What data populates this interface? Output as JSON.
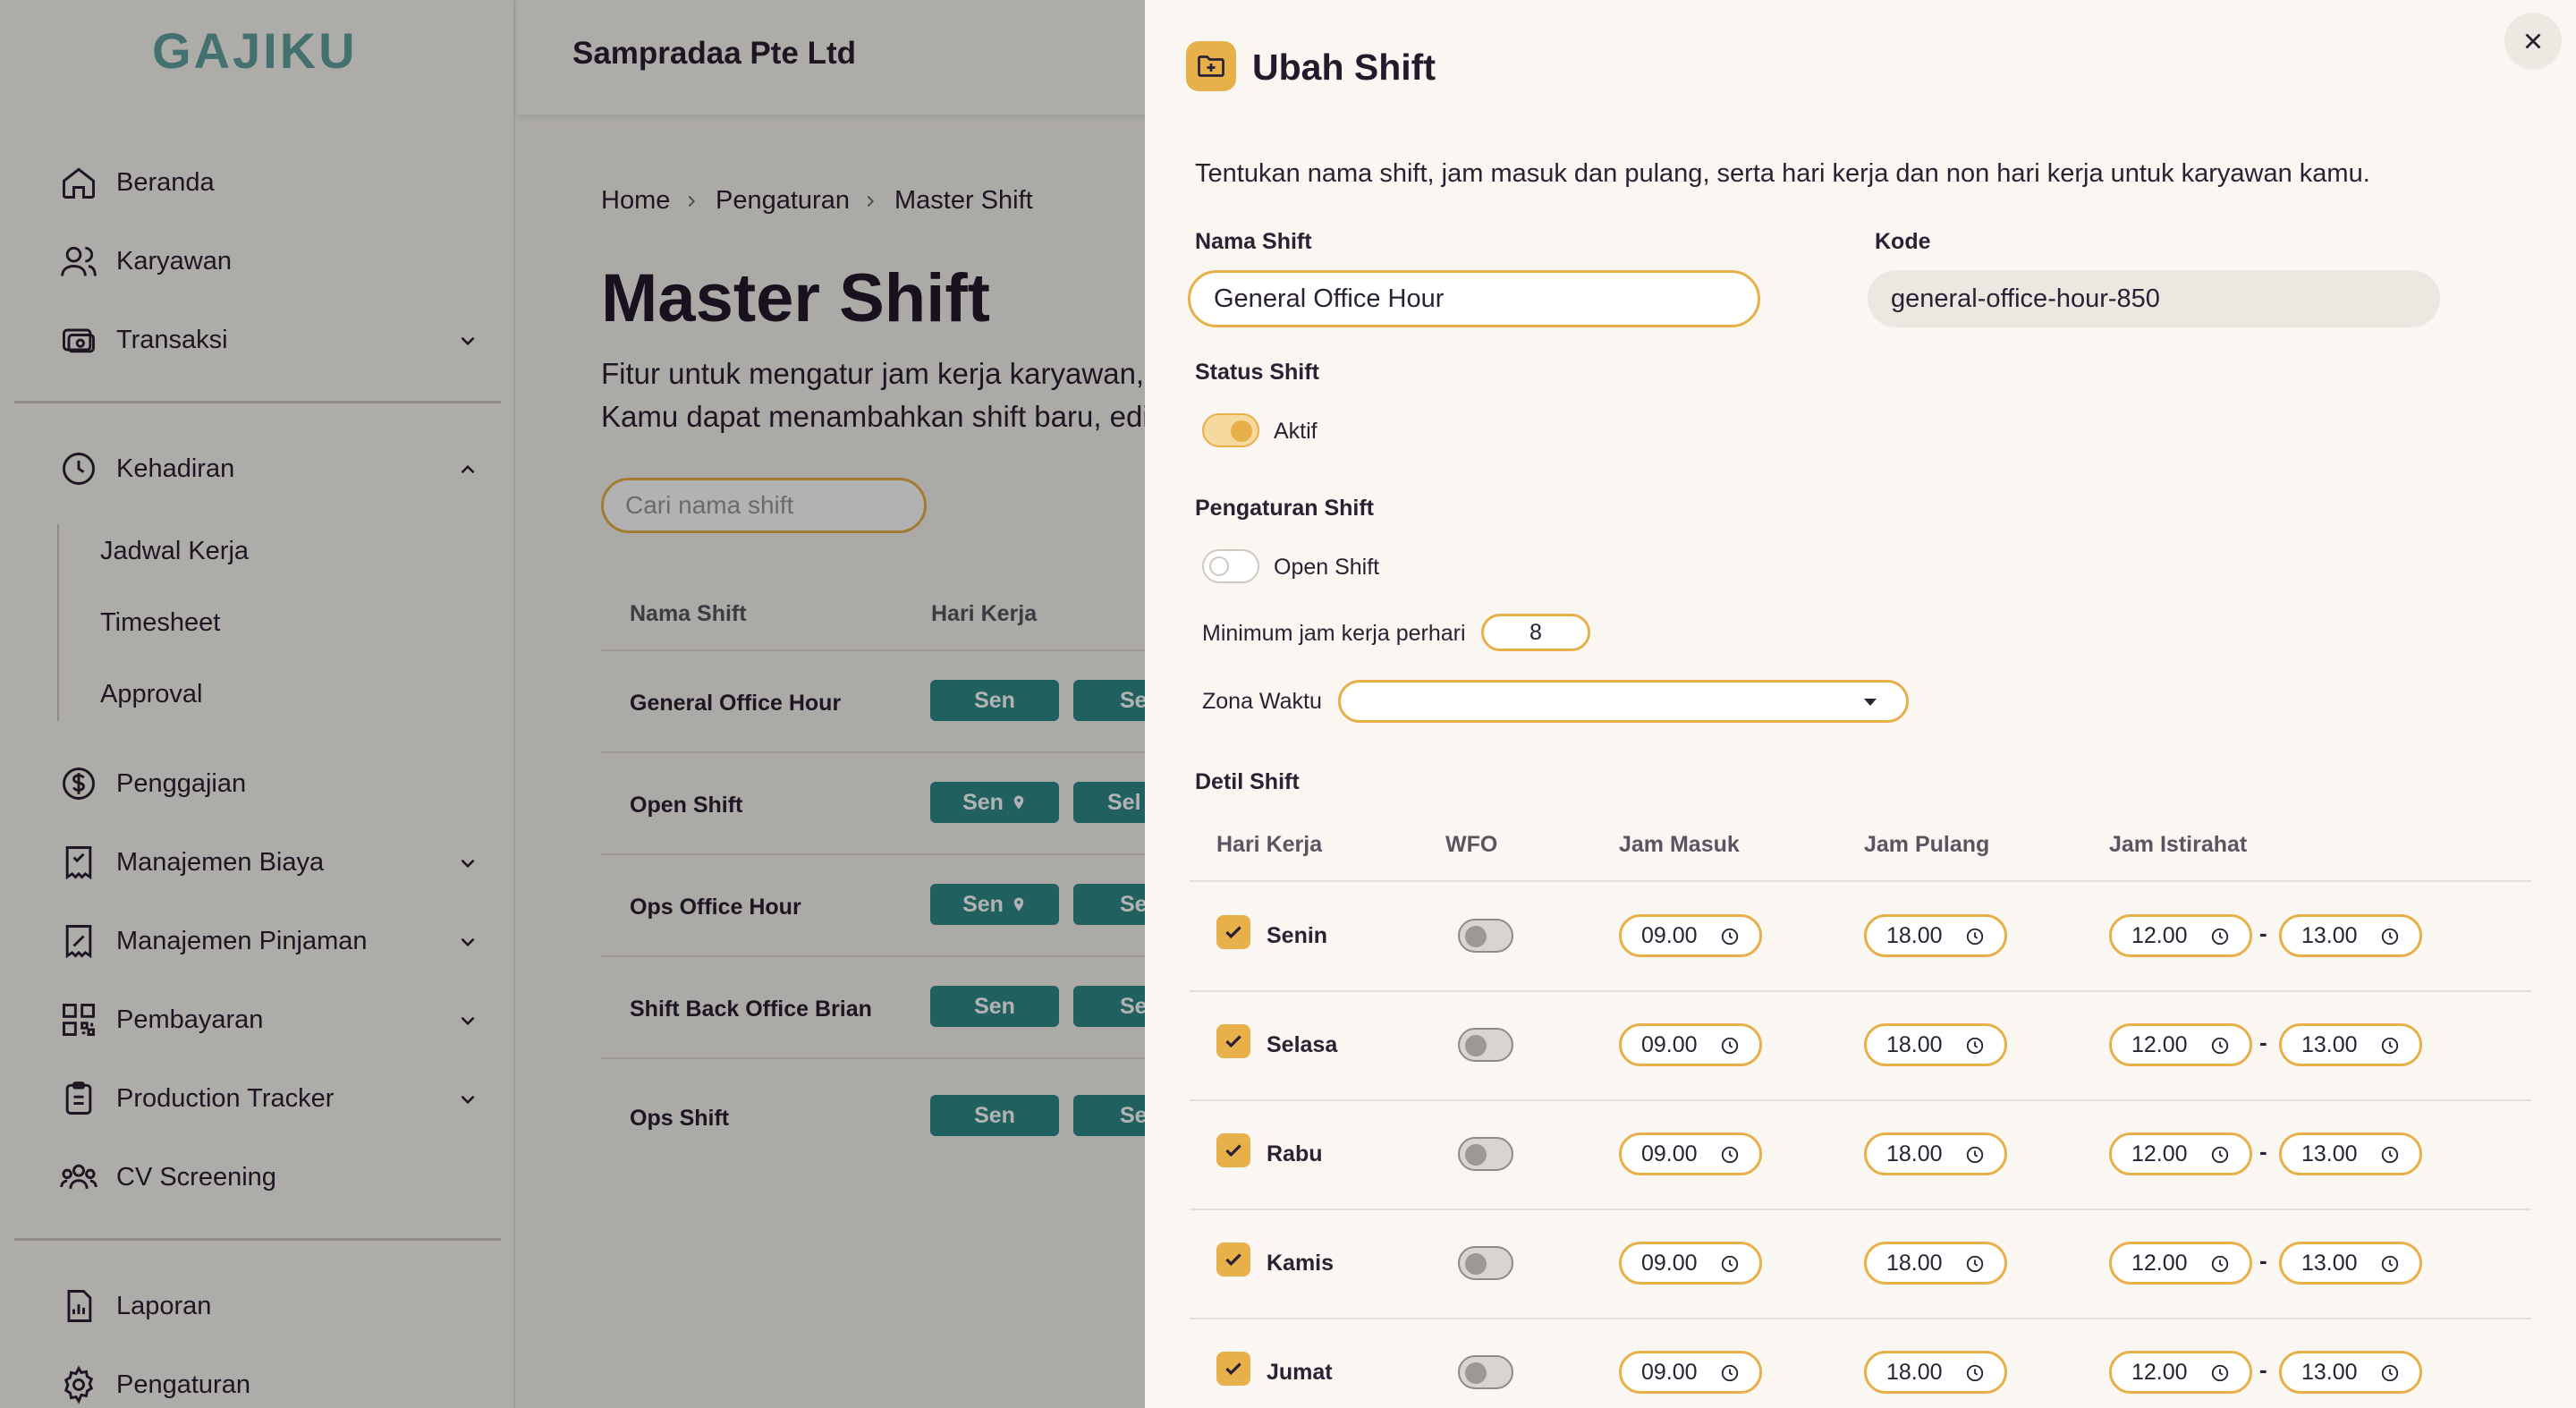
{
  "app": {
    "logo": "GAJIKU",
    "company": "Sampradaa Pte Ltd"
  },
  "sidebar": {
    "items": [
      {
        "label": "Beranda",
        "icon": "home-icon"
      },
      {
        "label": "Karyawan",
        "icon": "users-icon"
      },
      {
        "label": "Transaksi",
        "icon": "transaction-icon"
      },
      {
        "label": "Kehadiran",
        "icon": "clock-icon"
      },
      {
        "label": "Penggajian",
        "icon": "dollar-icon"
      },
      {
        "label": "Manajemen Biaya",
        "icon": "receipt-icon"
      },
      {
        "label": "Manajemen Pinjaman",
        "icon": "loan-icon"
      },
      {
        "label": "Pembayaran",
        "icon": "qr-icon"
      },
      {
        "label": "Production Tracker",
        "icon": "clipboard-icon"
      },
      {
        "label": "CV Screening",
        "icon": "group-icon"
      },
      {
        "label": "Laporan",
        "icon": "report-icon"
      },
      {
        "label": "Pengaturan",
        "icon": "gear-icon"
      }
    ],
    "kehadiran_sub": [
      "Jadwal Kerja",
      "Timesheet",
      "Approval"
    ]
  },
  "breadcrumb": [
    "Home",
    "Pengaturan",
    "Master Shift"
  ],
  "page": {
    "title": "Master Shift",
    "desc_line1": "Fitur untuk mengatur jam kerja karyawan, l",
    "desc_line2": "Kamu dapat menambahkan shift baru, edit",
    "search_placeholder": "Cari nama shift"
  },
  "table": {
    "headers": [
      "Nama Shift",
      "Hari Kerja"
    ],
    "rows": [
      {
        "name": "General Office Hour",
        "day1": "Sen",
        "day2": "Se",
        "pin": false
      },
      {
        "name": "Open Shift",
        "day1": "Sen",
        "day2": "Sel",
        "pin": true
      },
      {
        "name": "Ops Office Hour",
        "day1": "Sen",
        "day2": "Se",
        "pin": true
      },
      {
        "name": "Shift Back Office Brian",
        "day1": "Sen",
        "day2": "Se",
        "pin": false
      },
      {
        "name": "Ops Shift",
        "day1": "Sen",
        "day2": "Se",
        "pin": false
      }
    ]
  },
  "drawer": {
    "title": "Ubah Shift",
    "description": "Tentukan nama shift, jam masuk dan pulang, serta hari kerja dan non hari kerja untuk karyawan kamu.",
    "nama_shift_label": "Nama Shift",
    "nama_shift_value": "General Office Hour",
    "kode_label": "Kode",
    "kode_value": "general-office-hour-850",
    "status_label": "Status Shift",
    "status_toggle_label": "Aktif",
    "status_on": true,
    "pengaturan_label": "Pengaturan Shift",
    "open_shift_label": "Open Shift",
    "open_shift_on": false,
    "min_jam_label": "Minimum jam kerja perhari",
    "min_jam_value": "8",
    "zona_label": "Zona Waktu",
    "zona_value": "",
    "detil_label": "Detil Shift",
    "detail_headers": [
      "Hari Kerja",
      "WFO",
      "Jam Masuk",
      "Jam Pulang",
      "Jam Istirahat"
    ],
    "days": [
      {
        "day": "Senin",
        "checked": true,
        "wfo": false,
        "masuk": "09.00",
        "pulang": "18.00",
        "ist_start": "12.00",
        "ist_end": "13.00"
      },
      {
        "day": "Selasa",
        "checked": true,
        "wfo": false,
        "masuk": "09.00",
        "pulang": "18.00",
        "ist_start": "12.00",
        "ist_end": "13.00"
      },
      {
        "day": "Rabu",
        "checked": true,
        "wfo": false,
        "masuk": "09.00",
        "pulang": "18.00",
        "ist_start": "12.00",
        "ist_end": "13.00"
      },
      {
        "day": "Kamis",
        "checked": true,
        "wfo": false,
        "masuk": "09.00",
        "pulang": "18.00",
        "ist_start": "12.00",
        "ist_end": "13.00"
      },
      {
        "day": "Jumat",
        "checked": true,
        "wfo": false,
        "masuk": "09.00",
        "pulang": "18.00",
        "ist_start": "12.00",
        "ist_end": "13.00"
      }
    ]
  },
  "colors": {
    "accent": "#e8b04a",
    "teal": "#2e8c89",
    "logo": "#5fa3a0"
  }
}
